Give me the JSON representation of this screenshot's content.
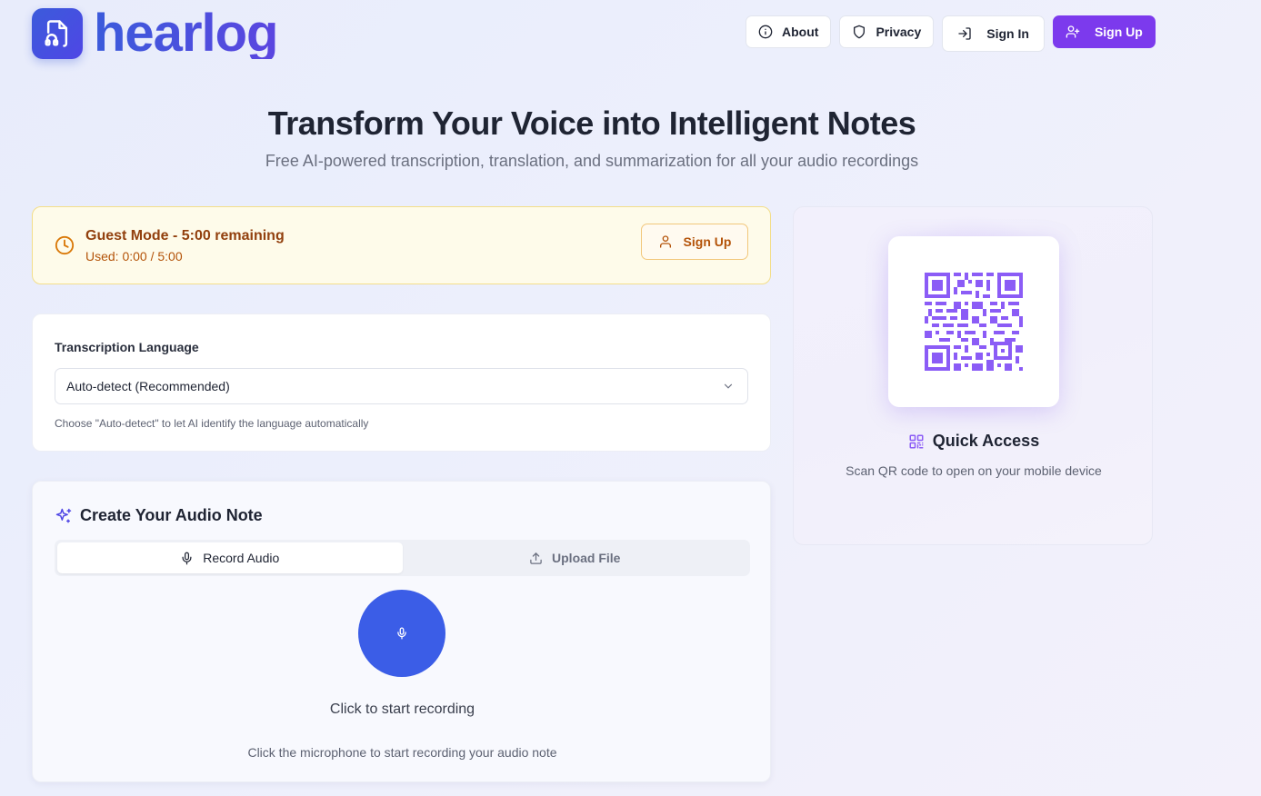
{
  "brand": {
    "name": "hearlog",
    "logo_icon": "file-headphones-icon"
  },
  "nav": {
    "about": "About",
    "privacy": "Privacy",
    "sign_in": "Sign In",
    "sign_up": "Sign Up"
  },
  "hero": {
    "title": "Transform Your Voice into Intelligent Notes",
    "subtitle": "Free AI-powered transcription, translation, and summarization for all your audio recordings"
  },
  "guest": {
    "title": "Guest Mode - 5:00 remaining",
    "used": "Used: 0:00 / 5:00",
    "signup_label": "Sign Up"
  },
  "language": {
    "label": "Transcription Language",
    "selected": "Auto-detect (Recommended)",
    "help": "Choose \"Auto-detect\" to let AI identify the language automatically"
  },
  "create": {
    "title": "Create Your Audio Note",
    "tabs": [
      {
        "label": "Record Audio",
        "active": true
      },
      {
        "label": "Upload File",
        "active": false
      }
    ],
    "record_prompt": "Click to start recording",
    "record_help": "Click the microphone to start recording your audio note"
  },
  "quick_access": {
    "title": "Quick Access",
    "subtitle": "Scan QR code to open on your mobile device"
  },
  "colors": {
    "brand": "#4453e0",
    "accent_purple": "#7c3aed",
    "mic_blue": "#3b5de7",
    "guest_amber": "#92400e",
    "qr_purple": "#8b5cf6"
  }
}
